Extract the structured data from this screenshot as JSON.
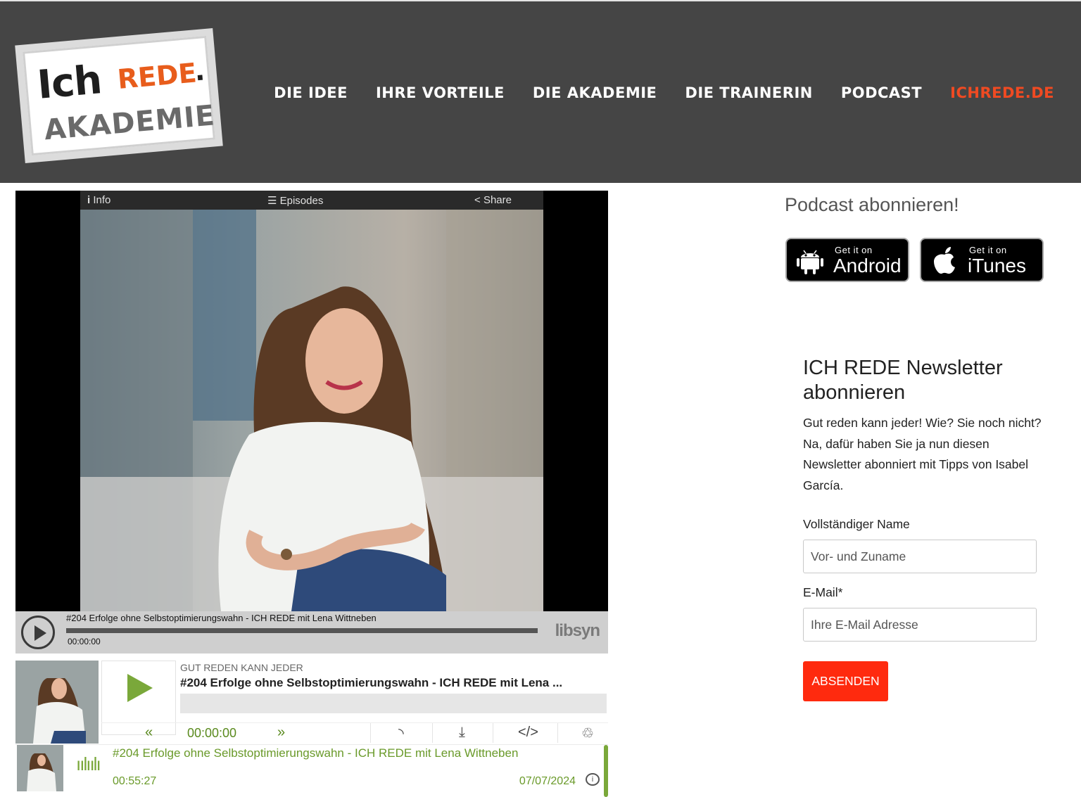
{
  "header": {
    "logo": {
      "line1": "Ich",
      "line1_accent": "REDE",
      "line1_dot": ".",
      "line2": "AKADEMIE"
    },
    "nav": [
      "DIE IDEE",
      "IHRE VORTEILE",
      "DIE AKADEMIE",
      "DIE TRAINERIN",
      "PODCAST",
      "ICHREDE.DE"
    ],
    "colors": {
      "bg": "#454545",
      "accent": "#f04a22",
      "logo_accent": "#e85d1c"
    }
  },
  "player": {
    "top_bar": {
      "info": "Info",
      "episodes": "Episodes",
      "share": "Share"
    },
    "episode_title": "#204 Erfolge ohne Selbstoptimierungswahn - ICH REDE mit Lena Wittneben",
    "time": "00:00:00",
    "brand": "libsyn"
  },
  "mini_player": {
    "show": "GUT REDEN KANN JEDER",
    "title": "#204 Erfolge ohne Selbstoptimierungswahn - ICH REDE mit Lena ...",
    "time": "00:00:00",
    "accent": "#7aa83a",
    "icons": [
      "rewind-icon",
      "fast-forward-icon",
      "rss-icon",
      "download-icon",
      "embed-icon",
      "share-icon"
    ]
  },
  "episode_list": [
    {
      "title": "#204 Erfolge ohne Selbstoptimierungswahn - ICH REDE mit Lena Wittneben",
      "duration": "00:55:27",
      "date": "07/07/2024"
    }
  ],
  "sidebar": {
    "subscribe_title": "Podcast abonnieren!",
    "badges": [
      {
        "small": "Get it on",
        "big": "Android",
        "icon": "android-icon"
      },
      {
        "small": "Get it on",
        "big": "iTunes",
        "icon": "apple-icon"
      }
    ],
    "newsletter": {
      "title": "ICH REDE Newsletter abonnieren",
      "text": "Gut reden kann jeder! Wie? Sie noch nicht? Na, dafür haben Sie ja nun diesen Newsletter abonniert mit Tipps von Isabel García.",
      "name_label": "Vollständiger Name",
      "name_placeholder": "Vor- und Zuname",
      "email_label": "E-Mail*",
      "email_placeholder": "Ihre E-Mail Adresse",
      "submit": "ABSENDEN",
      "submit_color": "#ff2a0e"
    }
  }
}
